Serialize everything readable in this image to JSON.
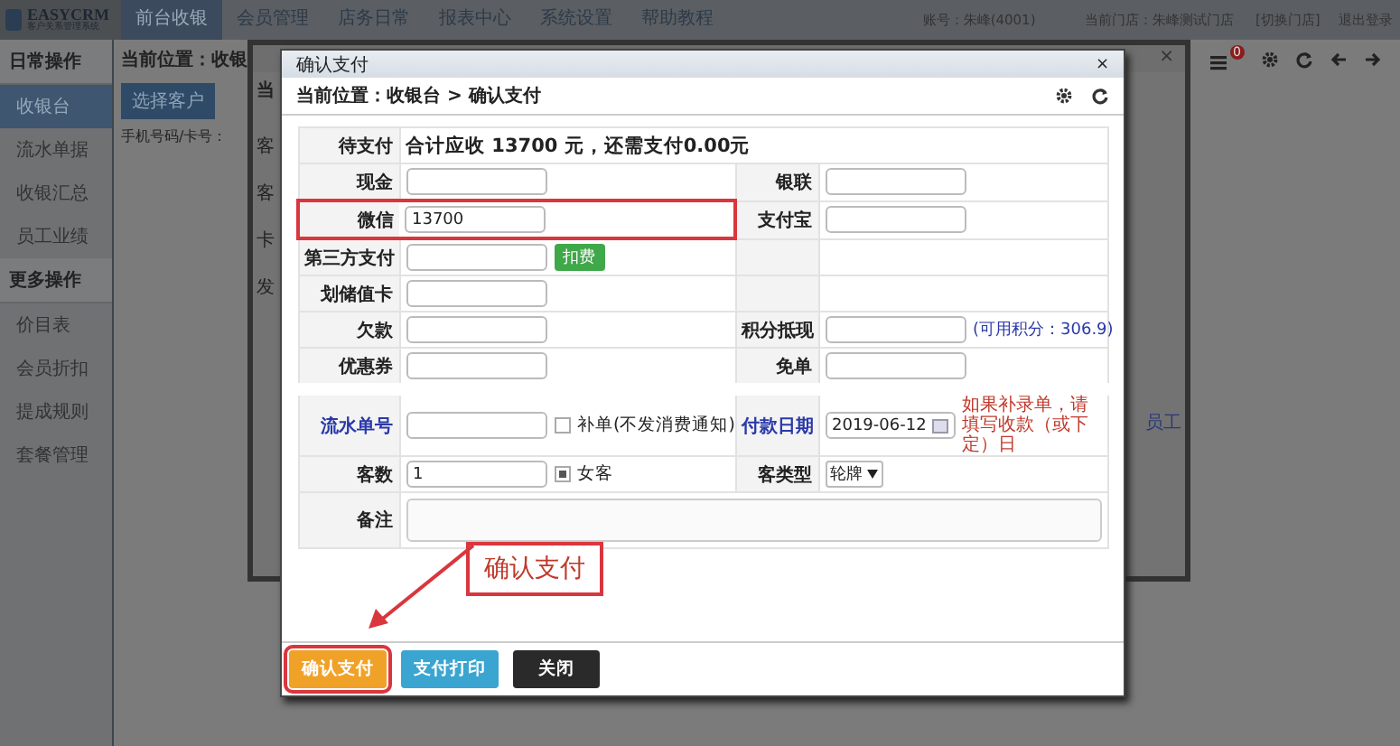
{
  "app": {
    "logo": "EASYCRM",
    "logo_sub": "客户关系管理系统",
    "nav": [
      {
        "label": "前台收银",
        "selected": true
      },
      {
        "label": "会员管理",
        "selected": false
      },
      {
        "label": "店务日常",
        "selected": false
      },
      {
        "label": "报表中心",
        "selected": false
      },
      {
        "label": "系统设置",
        "selected": false
      },
      {
        "label": "帮助教程",
        "selected": false
      }
    ],
    "account": "账号：朱峰(4001)",
    "store": "当前门店：朱峰测试门店",
    "switch_store": "[切换门店]",
    "logout": "退出登录",
    "notifications": "0"
  },
  "sidebar": [
    {
      "title": "日常操作",
      "items": [
        {
          "label": "收银台",
          "selected": true
        },
        {
          "label": "流水单据",
          "selected": false
        },
        {
          "label": "收银汇总",
          "selected": false
        },
        {
          "label": "员工业绩",
          "selected": false
        }
      ]
    },
    {
      "title": "更多操作",
      "items": [
        {
          "label": "价目表",
          "selected": false
        },
        {
          "label": "会员折扣",
          "selected": false
        },
        {
          "label": "提成规则",
          "selected": false
        },
        {
          "label": "套餐管理",
          "selected": false
        }
      ]
    }
  ],
  "page": {
    "breadcrumb": "当前位置：收银",
    "select_customer": "选择客户",
    "phone_label": "手机号码/卡号："
  },
  "back_dialog": {
    "heading": "当",
    "fragments": [
      "客",
      "客",
      "卡",
      "发"
    ],
    "side_text": "员工",
    "close": "×"
  },
  "dialog": {
    "title": "确认支付",
    "close": "×",
    "breadcrumb": "当前位置：收银台 > 确认支付",
    "due_label": "待支付",
    "due_text": "合计应收 13700 元，还需支付0.00元",
    "rows": [
      {
        "gap_before": false,
        "highlighted": false,
        "left": {
          "label": "现金",
          "link": false,
          "field": {
            "kind": "input"
          }
        },
        "right": {
          "label": "银联",
          "link": false,
          "field": {
            "kind": "input"
          }
        }
      },
      {
        "gap_before": false,
        "highlighted": true,
        "left": {
          "label": "微信",
          "link": false,
          "field": {
            "kind": "input",
            "value": "13700"
          }
        },
        "right": {
          "label": "支付宝",
          "link": false,
          "field": {
            "kind": "input"
          }
        }
      },
      {
        "gap_before": false,
        "highlighted": false,
        "left": {
          "label": "第三方支付",
          "link": false,
          "field": {
            "kind": "input"
          },
          "extra": {
            "kind": "button",
            "text": "扣费"
          }
        }
      },
      {
        "gap_before": false,
        "highlighted": false,
        "left": {
          "label": "划储值卡",
          "link": false,
          "field": {
            "kind": "input"
          }
        }
      },
      {
        "gap_before": false,
        "highlighted": false,
        "left": {
          "label": "欠款",
          "link": false,
          "field": {
            "kind": "input"
          }
        },
        "right": {
          "label": "积分抵现",
          "link": false,
          "field": {
            "kind": "input"
          },
          "extra": {
            "kind": "info",
            "text": "(可用积分：306.9)"
          }
        }
      },
      {
        "gap_before": false,
        "highlighted": false,
        "left": {
          "label": "优惠券",
          "link": false,
          "field": {
            "kind": "input"
          }
        },
        "right": {
          "label": "免单",
          "link": false,
          "field": {
            "kind": "input"
          }
        }
      },
      {
        "gap_before": true,
        "highlighted": false,
        "left": {
          "label": "流水单号",
          "link": true,
          "field": {
            "kind": "input"
          },
          "extra": {
            "kind": "checkbox",
            "text": "补单(不发消费通知)",
            "checked": false
          }
        },
        "right": {
          "label": "付款日期",
          "link": true,
          "field": {
            "kind": "date",
            "value": "2019-06-12"
          },
          "extra": {
            "kind": "warning",
            "text": "如果补录单，请填写收款（或下定）日"
          }
        }
      },
      {
        "gap_before": false,
        "highlighted": false,
        "left": {
          "label": "客数",
          "link": false,
          "field": {
            "kind": "input",
            "value": "1"
          },
          "extra": {
            "kind": "checkbox",
            "text": "女客",
            "checked": true
          }
        },
        "right": {
          "label": "客类型",
          "link": false,
          "field": {
            "kind": "select",
            "value": "轮牌"
          }
        }
      }
    ],
    "notes_label": "备注",
    "buttons": [
      {
        "label": "确认支付",
        "kind": "primary",
        "highlighted": true
      },
      {
        "label": "支付打印",
        "kind": "info",
        "highlighted": false
      },
      {
        "label": "关闭",
        "kind": "dark",
        "highlighted": false
      }
    ],
    "callout": "确认支付"
  }
}
